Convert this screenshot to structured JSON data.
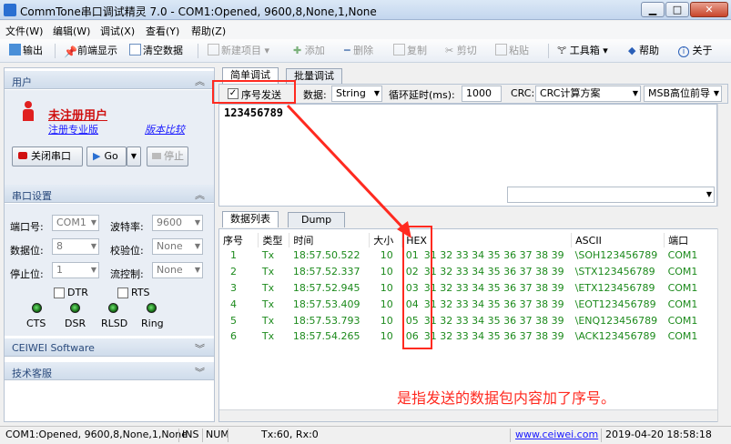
{
  "window": {
    "title": "CommTone串口调试精灵 7.0 - COM1:Opened, 9600,8,None,1,None",
    "min": "▁",
    "max": "□",
    "close": "✕"
  },
  "menu": [
    "文件(W)",
    "编辑(W)",
    "调试(X)",
    "查看(Y)",
    "帮助(Z)"
  ],
  "toolbar": {
    "output": "输出",
    "front_display": "前端显示",
    "clear": "清空数据",
    "new_item": "新建项目",
    "add": "添加",
    "delete": "删除",
    "copy": "复制",
    "cut": "剪切",
    "paste": "粘贴",
    "toolbox": "工具箱",
    "help": "帮助",
    "about": "关于"
  },
  "user_section": {
    "header": "用户",
    "unregistered": "未注册用户",
    "register_pro": "注册专业版",
    "version_compare": "版本比较"
  },
  "port_controls": {
    "close_port": "关闭串口",
    "go": "Go",
    "stop": "停止"
  },
  "serial_settings": {
    "header": "串口设置",
    "port_label": "端口号:",
    "port": "COM1",
    "baud_label": "波特率:",
    "baud": "9600",
    "data_bits_label": "数据位:",
    "data_bits": "8",
    "parity_label": "校验位:",
    "parity": "None",
    "stop_bits_label": "停止位:",
    "stop_bits": "1",
    "flow_label": "流控制:",
    "flow": "None",
    "dtr": "DTR",
    "rts": "RTS",
    "leds": [
      "CTS",
      "DSR",
      "RLSD",
      "Ring"
    ]
  },
  "sections": {
    "ceiwei": "CEIWEI Software",
    "support": "技术客服"
  },
  "tabs": {
    "simple": "简单调试",
    "batch": "批量调试",
    "data_list": "数据列表",
    "dump": "Dump"
  },
  "send_bar": {
    "seq_send": "序号发送",
    "data_label": "数据:",
    "data_type": "String",
    "loop_label": "循环延时(ms):",
    "loop_ms": "1000",
    "crc_label": "CRC:",
    "crc_scheme": "CRC计算方案",
    "msb": "MSB高位前导"
  },
  "send_text": "123456789",
  "table": {
    "headers": [
      "序号",
      "类型",
      "时间",
      "大小",
      "HEX",
      "ASCII",
      "端口"
    ],
    "rows": [
      {
        "n": "1",
        "type": "Tx",
        "time": "18:57.50.522",
        "size": "10",
        "seq": "01",
        "hex": "31 32 33 34 35 36 37 38 39",
        "ascii": "\\SOH123456789",
        "port": "COM1"
      },
      {
        "n": "2",
        "type": "Tx",
        "time": "18:57.52.337",
        "size": "10",
        "seq": "02",
        "hex": "31 32 33 34 35 36 37 38 39",
        "ascii": "\\STX123456789",
        "port": "COM1"
      },
      {
        "n": "3",
        "type": "Tx",
        "time": "18:57.52.945",
        "size": "10",
        "seq": "03",
        "hex": "31 32 33 34 35 36 37 38 39",
        "ascii": "\\ETX123456789",
        "port": "COM1"
      },
      {
        "n": "4",
        "type": "Tx",
        "time": "18:57.53.409",
        "size": "10",
        "seq": "04",
        "hex": "31 32 33 34 35 36 37 38 39",
        "ascii": "\\EOT123456789",
        "port": "COM1"
      },
      {
        "n": "5",
        "type": "Tx",
        "time": "18:57.53.793",
        "size": "10",
        "seq": "05",
        "hex": "31 32 33 34 35 36 37 38 39",
        "ascii": "\\ENQ123456789",
        "port": "COM1"
      },
      {
        "n": "6",
        "type": "Tx",
        "time": "18:57.54.265",
        "size": "10",
        "seq": "06",
        "hex": "31 32 33 34 35 36 37 38 39",
        "ascii": "\\ACK123456789",
        "port": "COM1"
      }
    ]
  },
  "annotation": "是指发送的数据包内容加了序号。",
  "status": {
    "port": "COM1:Opened, 9600,8,None,1,None",
    "ins": "INS",
    "num": "NUM",
    "txrx": "Tx:60, Rx:0",
    "url": "www.ceiwei.com",
    "datetime": "2019-04-20 18:58:18"
  },
  "colors": {
    "accent_red": "#ff2a20",
    "data_green": "#1c8a1c",
    "link_blue": "#1a1aff"
  }
}
